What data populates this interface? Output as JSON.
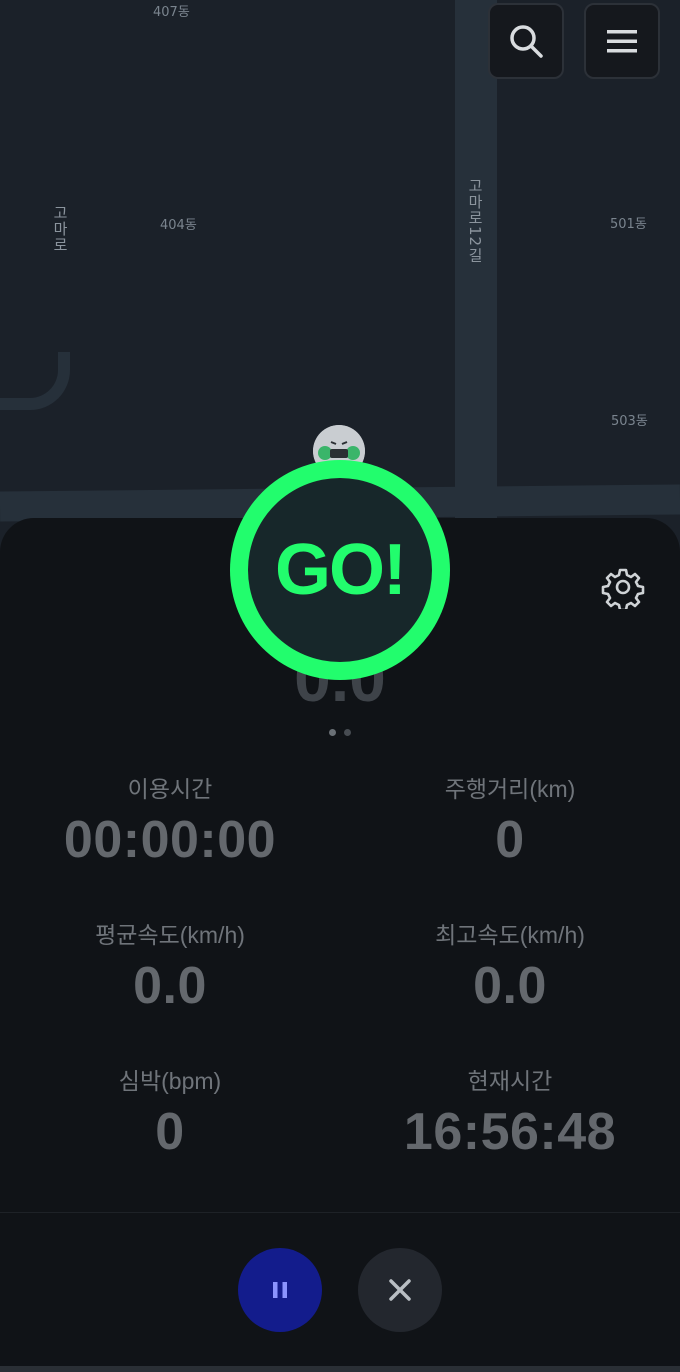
{
  "map": {
    "labels": {
      "l407": "407동",
      "l404": "404동",
      "l501": "501동",
      "l503": "503동"
    },
    "street_left": "고마로",
    "street_right": "고마로12길"
  },
  "header": {
    "search_icon": "search-icon",
    "menu_icon": "menu-icon"
  },
  "go_badge": {
    "text": "GO!"
  },
  "speed": {
    "value": "0.0"
  },
  "pager": {
    "count": 2,
    "active": 0
  },
  "stats": {
    "usage_time": {
      "label": "이용시간",
      "value": "00:00:00"
    },
    "distance": {
      "label": "주행거리(km)",
      "value": "0"
    },
    "avg_speed": {
      "label": "평균속도(km/h)",
      "value": "0.0"
    },
    "max_speed": {
      "label": "최고속도(km/h)",
      "value": "0.0"
    },
    "heart_rate": {
      "label": "심박(bpm)",
      "value": "0"
    },
    "current_time": {
      "label": "현재시간",
      "value": "16:56:48"
    }
  },
  "controls": {
    "pause_icon": "pause-icon",
    "close_icon": "close-icon"
  },
  "colors": {
    "go_green": "#22fd6d",
    "pause_blue": "#131c8c"
  }
}
